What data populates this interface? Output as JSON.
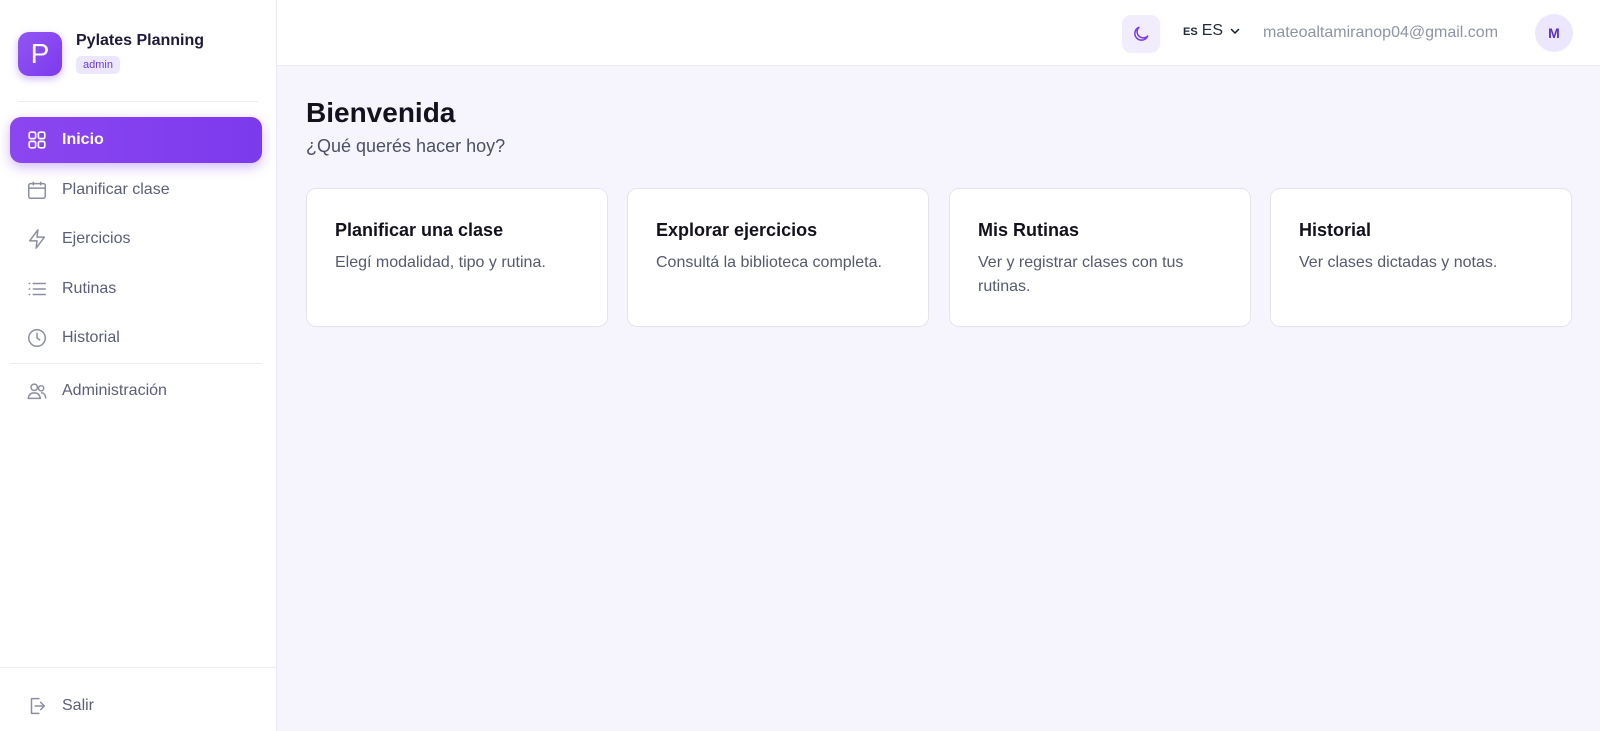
{
  "brand": {
    "logo_letter": "P",
    "name": "Pylates Planning",
    "role_badge": "admin"
  },
  "sidebar": {
    "items": [
      {
        "label": "Inicio",
        "icon": "grid-icon",
        "active": true
      },
      {
        "label": "Planificar clase",
        "icon": "calendar-icon",
        "active": false
      },
      {
        "label": "Ejercicios",
        "icon": "lightning-icon",
        "active": false
      },
      {
        "label": "Rutinas",
        "icon": "list-icon",
        "active": false
      },
      {
        "label": "Historial",
        "icon": "clock-icon",
        "active": false
      },
      {
        "label": "Administración",
        "icon": "users-icon",
        "active": false
      }
    ],
    "logout_label": "Salir"
  },
  "topbar": {
    "theme_icon": "moon-icon",
    "lang_code": "ES",
    "lang_label": "ES",
    "user_email": "mateoaltamiranop04@gmail.com",
    "avatar_initial": "M"
  },
  "main": {
    "title": "Bienvenida",
    "subtitle": "¿Qué querés hacer hoy?",
    "cards": [
      {
        "title": "Planificar una clase",
        "description": "Elegí modalidad, tipo y rutina."
      },
      {
        "title": "Explorar ejercicios",
        "description": "Consultá la biblioteca completa."
      },
      {
        "title": "Mis Rutinas",
        "description": "Ver y registrar clases con tus rutinas."
      },
      {
        "title": "Historial",
        "description": "Ver clases dictadas y notas."
      }
    ]
  },
  "colors": {
    "accent": "#7c3aed",
    "background": "#f6f4fd",
    "badge_bg": "#ede7fd"
  }
}
